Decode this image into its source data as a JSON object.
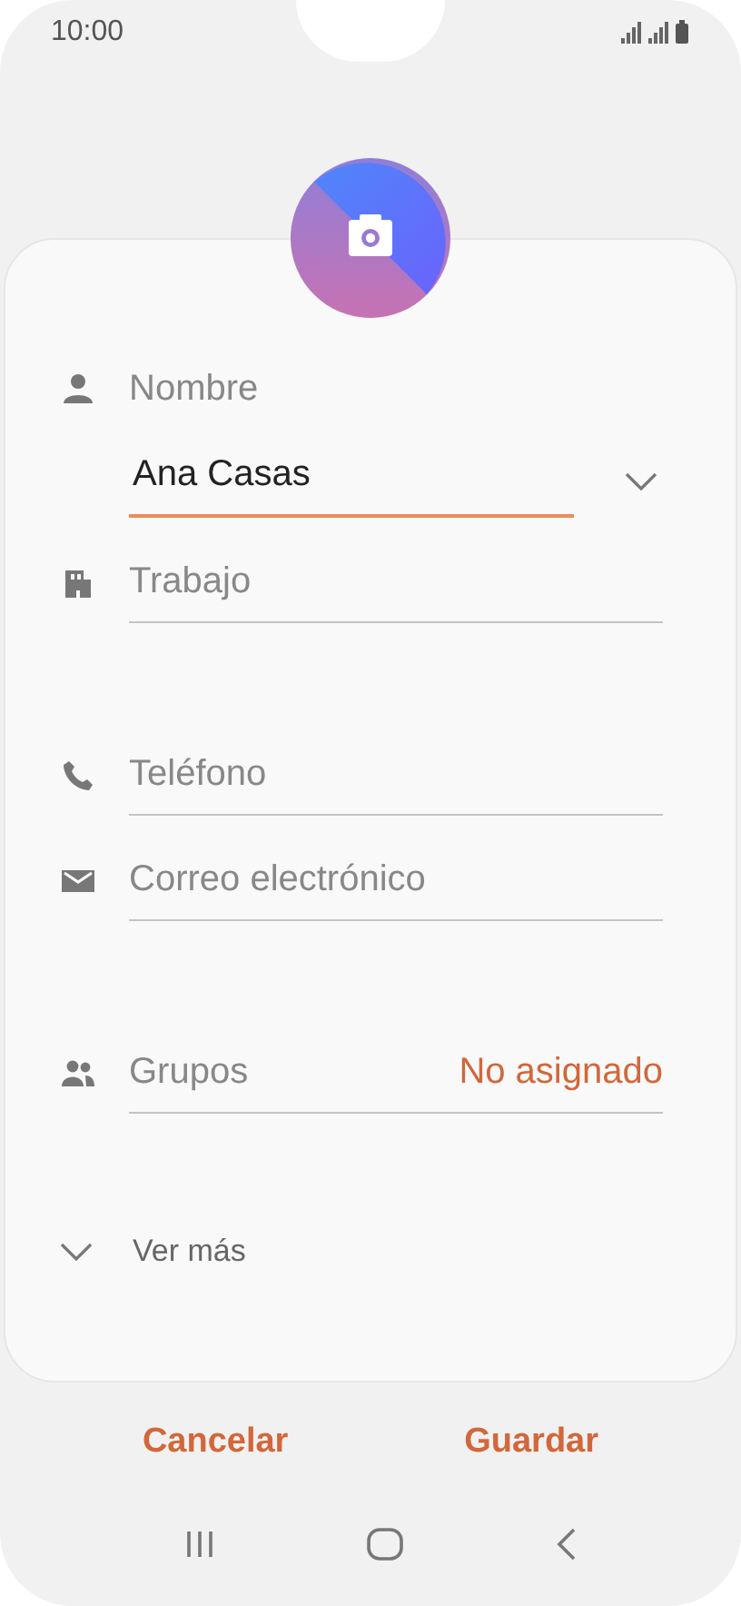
{
  "status_bar": {
    "time": "10:00"
  },
  "sections": [
    [
      {
        "kind": "name",
        "label": "Nombre",
        "value": "Ana Casas",
        "focused": true
      },
      {
        "kind": "company",
        "placeholder": "Trabajo",
        "focused": false
      }
    ],
    [
      {
        "kind": "phone",
        "placeholder": "Teléfono",
        "focused": false
      },
      {
        "kind": "email",
        "placeholder": "Correo electrónico",
        "focused": false
      }
    ],
    [
      {
        "kind": "groups",
        "label": "Grupos",
        "value": "No asignado"
      }
    ]
  ],
  "more": {
    "label": "Ver más",
    "expanded": false
  },
  "buttons": [
    "Cancelar",
    "Guardar"
  ]
}
